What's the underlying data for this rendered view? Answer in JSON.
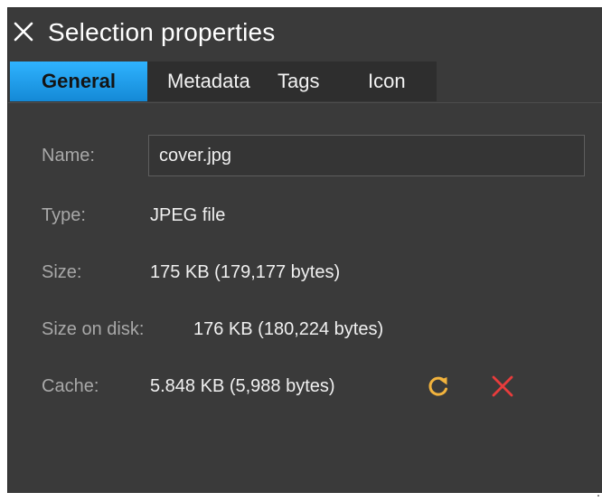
{
  "dialog": {
    "title": "Selection properties"
  },
  "tabs": [
    {
      "label": "General",
      "active": true
    },
    {
      "label": "Metadata",
      "active": false
    },
    {
      "label": "Tags",
      "active": false
    },
    {
      "label": "Icon",
      "active": false
    }
  ],
  "general": {
    "name_label": "Name:",
    "name_value": "cover.jpg",
    "type_label": "Type:",
    "type_value": "JPEG file",
    "size_label": "Size:",
    "size_value": "175 KB (179,177 bytes)",
    "size_on_disk_label": "Size on disk:",
    "size_on_disk_value": "176 KB (180,224 bytes)",
    "cache_label": "Cache:",
    "cache_value": "5.848 KB (5,988 bytes)"
  },
  "icons": {
    "close": "close-icon",
    "refresh": "refresh-icon",
    "clear": "clear-cache-icon"
  },
  "colors": {
    "background": "#3a3a3a",
    "active_tab": "#1e9ef0",
    "refresh_icon": "#f2b33d",
    "clear_icon": "#e83c3c"
  }
}
